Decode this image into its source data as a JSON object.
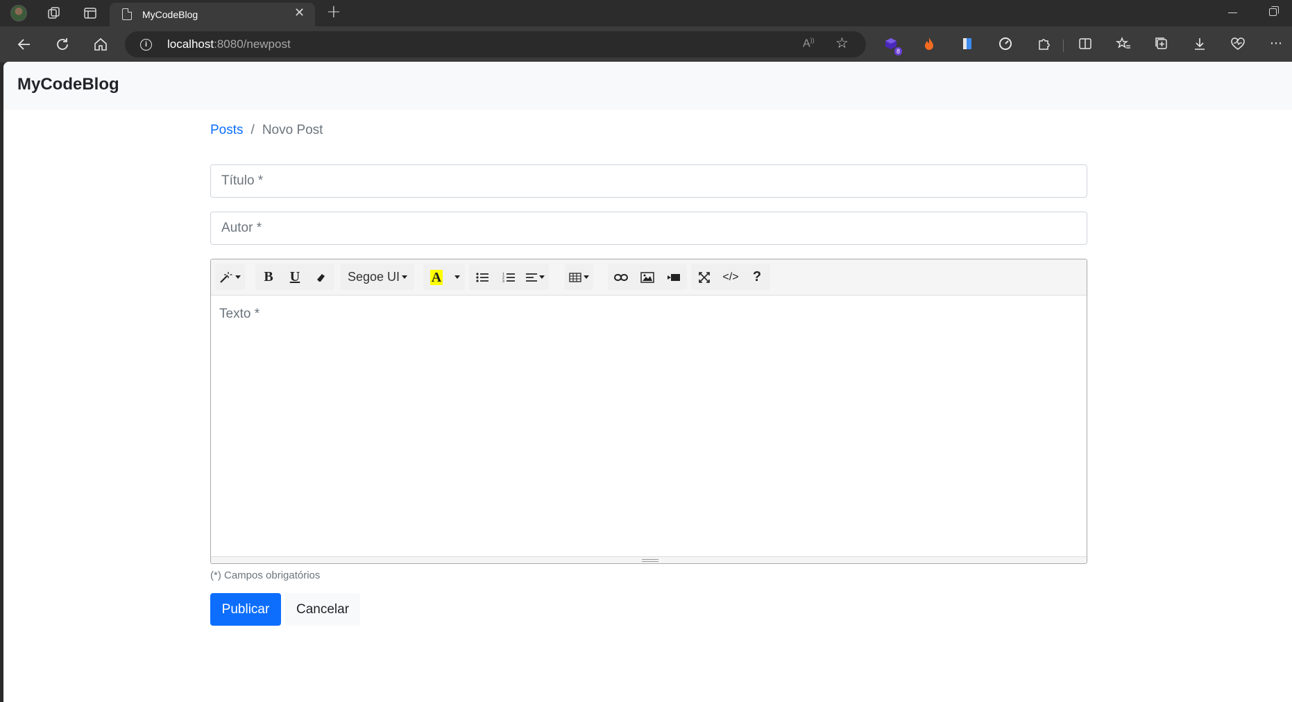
{
  "browser": {
    "tab_title": "MyCodeBlog",
    "url_host": "localhost",
    "url_rest": ":8080/newpost",
    "extension_badge": "8"
  },
  "site": {
    "brand": "MyCodeBlog"
  },
  "breadcrumb": {
    "link": "Posts",
    "separator": "/",
    "active": "Novo Post"
  },
  "form": {
    "title_placeholder": "Título *",
    "author_placeholder": "Autor *",
    "text_placeholder": "Texto *",
    "required_note": "(*) Campos obrigatórios",
    "submit_label": "Publicar",
    "cancel_label": "Cancelar"
  },
  "toolbar": {
    "bold": "B",
    "underline": "U",
    "font_name": "Segoe UI",
    "highlight": "A",
    "code_view": "</>",
    "help": "?"
  },
  "colors": {
    "primary": "#0d6efd",
    "highlight": "#ffff00"
  }
}
